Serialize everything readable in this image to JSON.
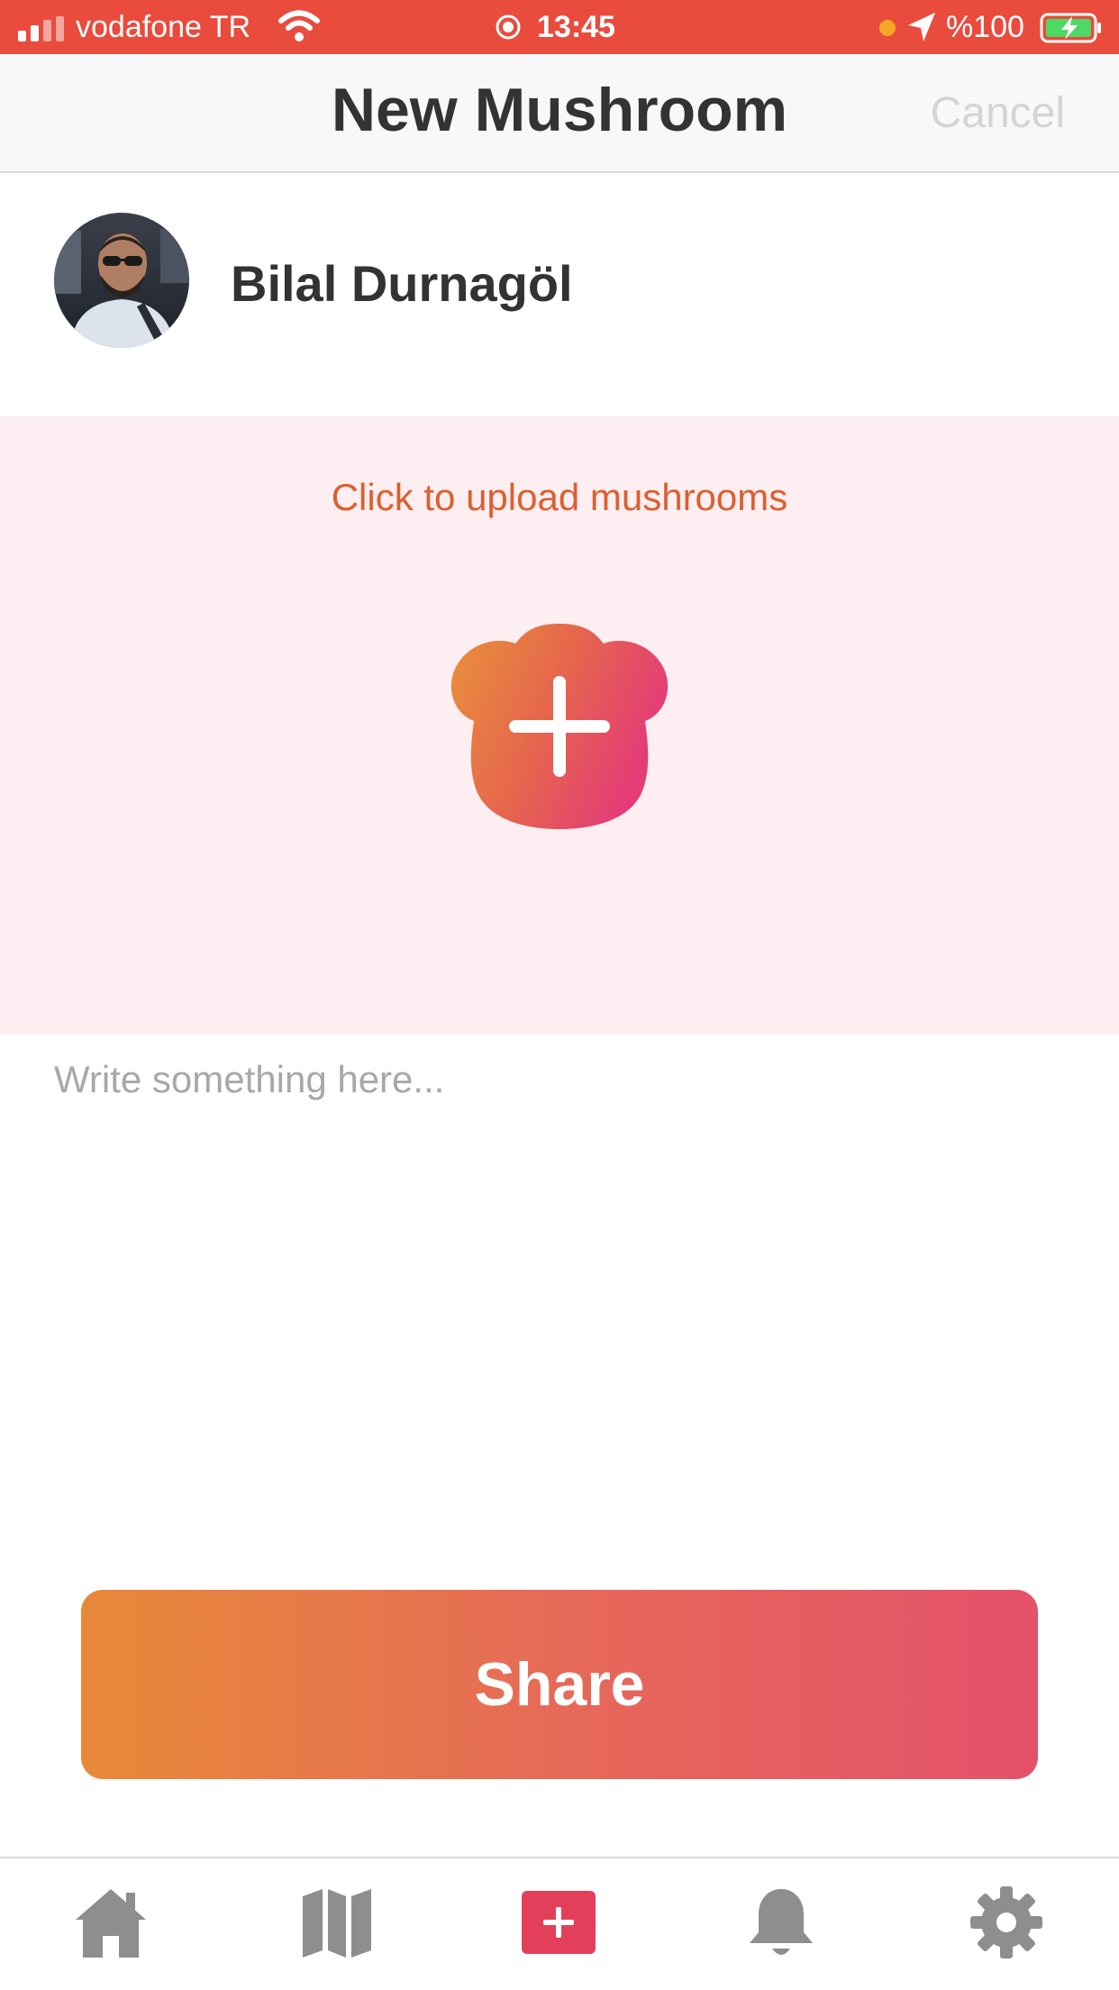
{
  "status_bar": {
    "carrier": "vodafone TR",
    "time": "13:45",
    "battery": "%100",
    "icons": [
      "signal-icon",
      "wifi-icon",
      "orientation-lock-icon",
      "location-icon",
      "battery-charging-icon"
    ]
  },
  "header": {
    "title": "New Mushroom",
    "cancel_label": "Cancel"
  },
  "user": {
    "name": "Bilal Durnagöl"
  },
  "upload": {
    "label": "Click to upload mushrooms",
    "icon": "mushroom-add-icon"
  },
  "post": {
    "placeholder": "Write something here...",
    "value": ""
  },
  "share": {
    "label": "Share"
  },
  "tab_bar": {
    "items": [
      {
        "icon": "home-icon"
      },
      {
        "icon": "map-icon"
      },
      {
        "icon": "add-icon",
        "active": true
      },
      {
        "icon": "bell-icon"
      },
      {
        "icon": "gear-icon"
      }
    ]
  },
  "colors": {
    "status_bar": "#E94B3C",
    "accent_orange": "#E88939",
    "accent_pink": "#E4516A",
    "upload_bg": "#FCEEF1",
    "upload_text": "#DD5F2E",
    "tab_inactive": "#8E8E8E"
  }
}
